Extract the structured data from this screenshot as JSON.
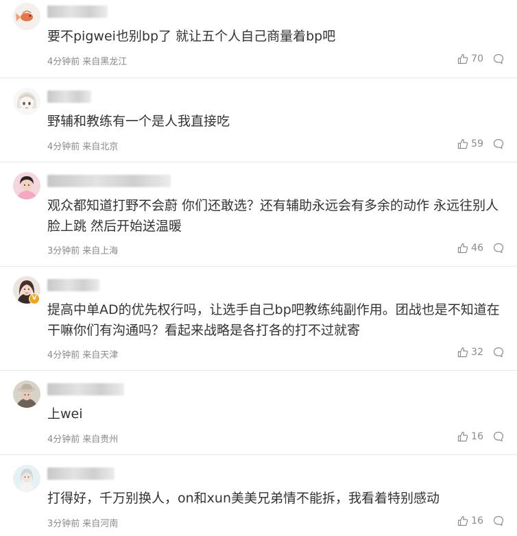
{
  "comments": [
    {
      "text": "要不pigwei也别bp了 就让五个人自己商量着bp吧",
      "time": "4分钟前",
      "location": "来自黑龙江",
      "likes": "70",
      "avatar_icon": "avatar-goldfish-icon"
    },
    {
      "text": "野辅和教练有一个是人我直接吃",
      "time": "4分钟前",
      "location": "来自北京",
      "likes": "59",
      "avatar_icon": "avatar-anime-girl-icon"
    },
    {
      "text": "观众都知道打野不会蔚 你们还敢选？还有辅助永远会有多余的动作 永远往别人脸上跳 然后开始送温暖",
      "time": "3分钟前",
      "location": "来自上海",
      "likes": "46",
      "avatar_icon": "avatar-photo-icon"
    },
    {
      "text": "提高中单AD的优先权行吗，让选手自己bp吧教练纯副作用。团战也是不知道在干嘛你们有沟通吗？看起来战略是各打各的打不过就寄",
      "time": "4分钟前",
      "location": "来自天津",
      "likes": "32",
      "avatar_icon": "avatar-photo-icon",
      "badge": "V"
    },
    {
      "text": "上wei",
      "time": "4分钟前",
      "location": "来自贵州",
      "likes": "16",
      "avatar_icon": "avatar-photo-icon"
    },
    {
      "text": "打得好，千万别换人，on和xun美美兄弟情不能拆，我看着特别感动",
      "time": "3分钟前",
      "location": "来自河南",
      "likes": "16",
      "avatar_icon": "avatar-photo-icon"
    }
  ]
}
